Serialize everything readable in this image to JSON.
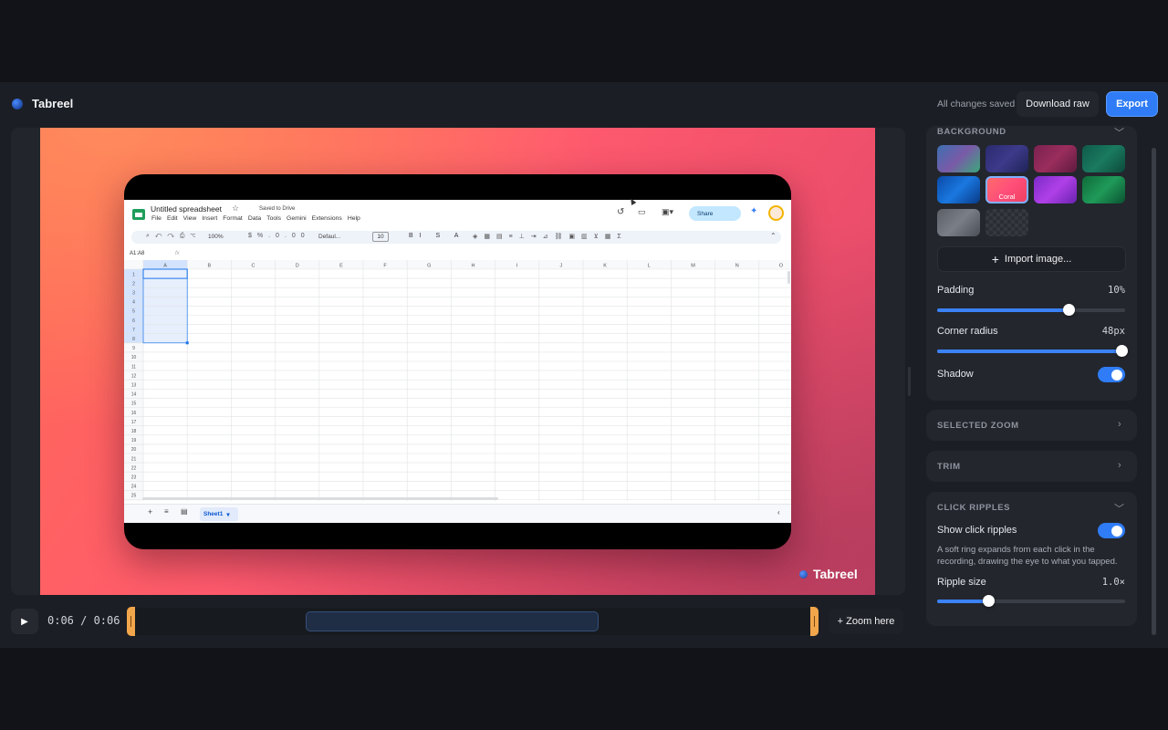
{
  "app": {
    "title": "Tabreel",
    "status": "All changes saved"
  },
  "toolbar": {
    "download_label": "Download raw",
    "export_label": "Export"
  },
  "player": {
    "time": "0:06 / 0:06",
    "zoom_here_label": "+ Zoom here"
  },
  "watermark": "Tabreel",
  "recording": {
    "doc_title": "Untitled spreadsheet",
    "saved_status": "Saved to Drive",
    "menu": [
      "File",
      "Edit",
      "View",
      "Insert",
      "Format",
      "Data",
      "Tools",
      "Gemini",
      "Extensions",
      "Help"
    ],
    "share_label": "Share",
    "zoom": "100%",
    "font": "Defaul...",
    "font_size": "10",
    "cell_ref": "A1:A8",
    "fx": "fx",
    "columns": [
      "A",
      "B",
      "C",
      "D",
      "E",
      "F",
      "G",
      "H",
      "I",
      "J",
      "K",
      "L",
      "M",
      "N",
      "O"
    ],
    "rows": [
      "1",
      "2",
      "3",
      "4",
      "5",
      "6",
      "7",
      "8",
      "9",
      "10",
      "11",
      "12",
      "13",
      "14",
      "15",
      "16",
      "17",
      "18",
      "19",
      "20",
      "21",
      "22",
      "23",
      "24",
      "25",
      "26"
    ],
    "sheet_tab": "Sheet1"
  },
  "background_section": {
    "title": "BACKGROUND",
    "selected_label": "Coral",
    "swatches": [
      {
        "name": "aurora",
        "colors": [
          "#3d6fb0",
          "#7a5aa8",
          "#3aa87a"
        ]
      },
      {
        "name": "indigo",
        "colors": [
          "#2a2a6e",
          "#3d3a8a",
          "#1f2357"
        ]
      },
      {
        "name": "wine",
        "colors": [
          "#7a2250",
          "#9a2d5c",
          "#5e1a3f"
        ]
      },
      {
        "name": "emerald",
        "colors": [
          "#0f5a48",
          "#1a7a60",
          "#0c4a3a"
        ]
      },
      {
        "name": "ocean",
        "colors": [
          "#0a4aa8",
          "#1a78e0",
          "#083a88"
        ]
      },
      {
        "name": "coral",
        "colors": [
          "#ff6b6b",
          "#ff4f7a",
          "#f04060"
        ]
      },
      {
        "name": "violet",
        "colors": [
          "#7a2ac8",
          "#b040e8",
          "#6a22b0"
        ]
      },
      {
        "name": "forest",
        "colors": [
          "#0f6a3a",
          "#1f9a58",
          "#0a5230"
        ]
      },
      {
        "name": "graphite",
        "colors": [
          "#5a5e66",
          "#7a7e86",
          "#4a4e56"
        ]
      },
      {
        "name": "transparent",
        "colors": [
          "#2a2d33",
          "#35383e",
          "#2a2d33"
        ]
      }
    ],
    "import_label": "Import image...",
    "padding": {
      "label": "Padding",
      "value": "10%",
      "level": 0.7
    },
    "corner_radius": {
      "label": "Corner radius",
      "value": "48px",
      "level": 0.98
    },
    "shadow": {
      "label": "Shadow",
      "on": true
    }
  },
  "selected_zoom": {
    "title": "SELECTED ZOOM"
  },
  "trim": {
    "title": "TRIM"
  },
  "click_ripples": {
    "title": "CLICK RIPPLES",
    "show_label": "Show click ripples",
    "show_on": true,
    "description": "A soft ring expands from each click in the recording, drawing the eye to what you tapped.",
    "ripple_size": {
      "label": "Ripple size",
      "value": "1.0×",
      "level": 0.27
    }
  },
  "accent": "#2f7cf6"
}
